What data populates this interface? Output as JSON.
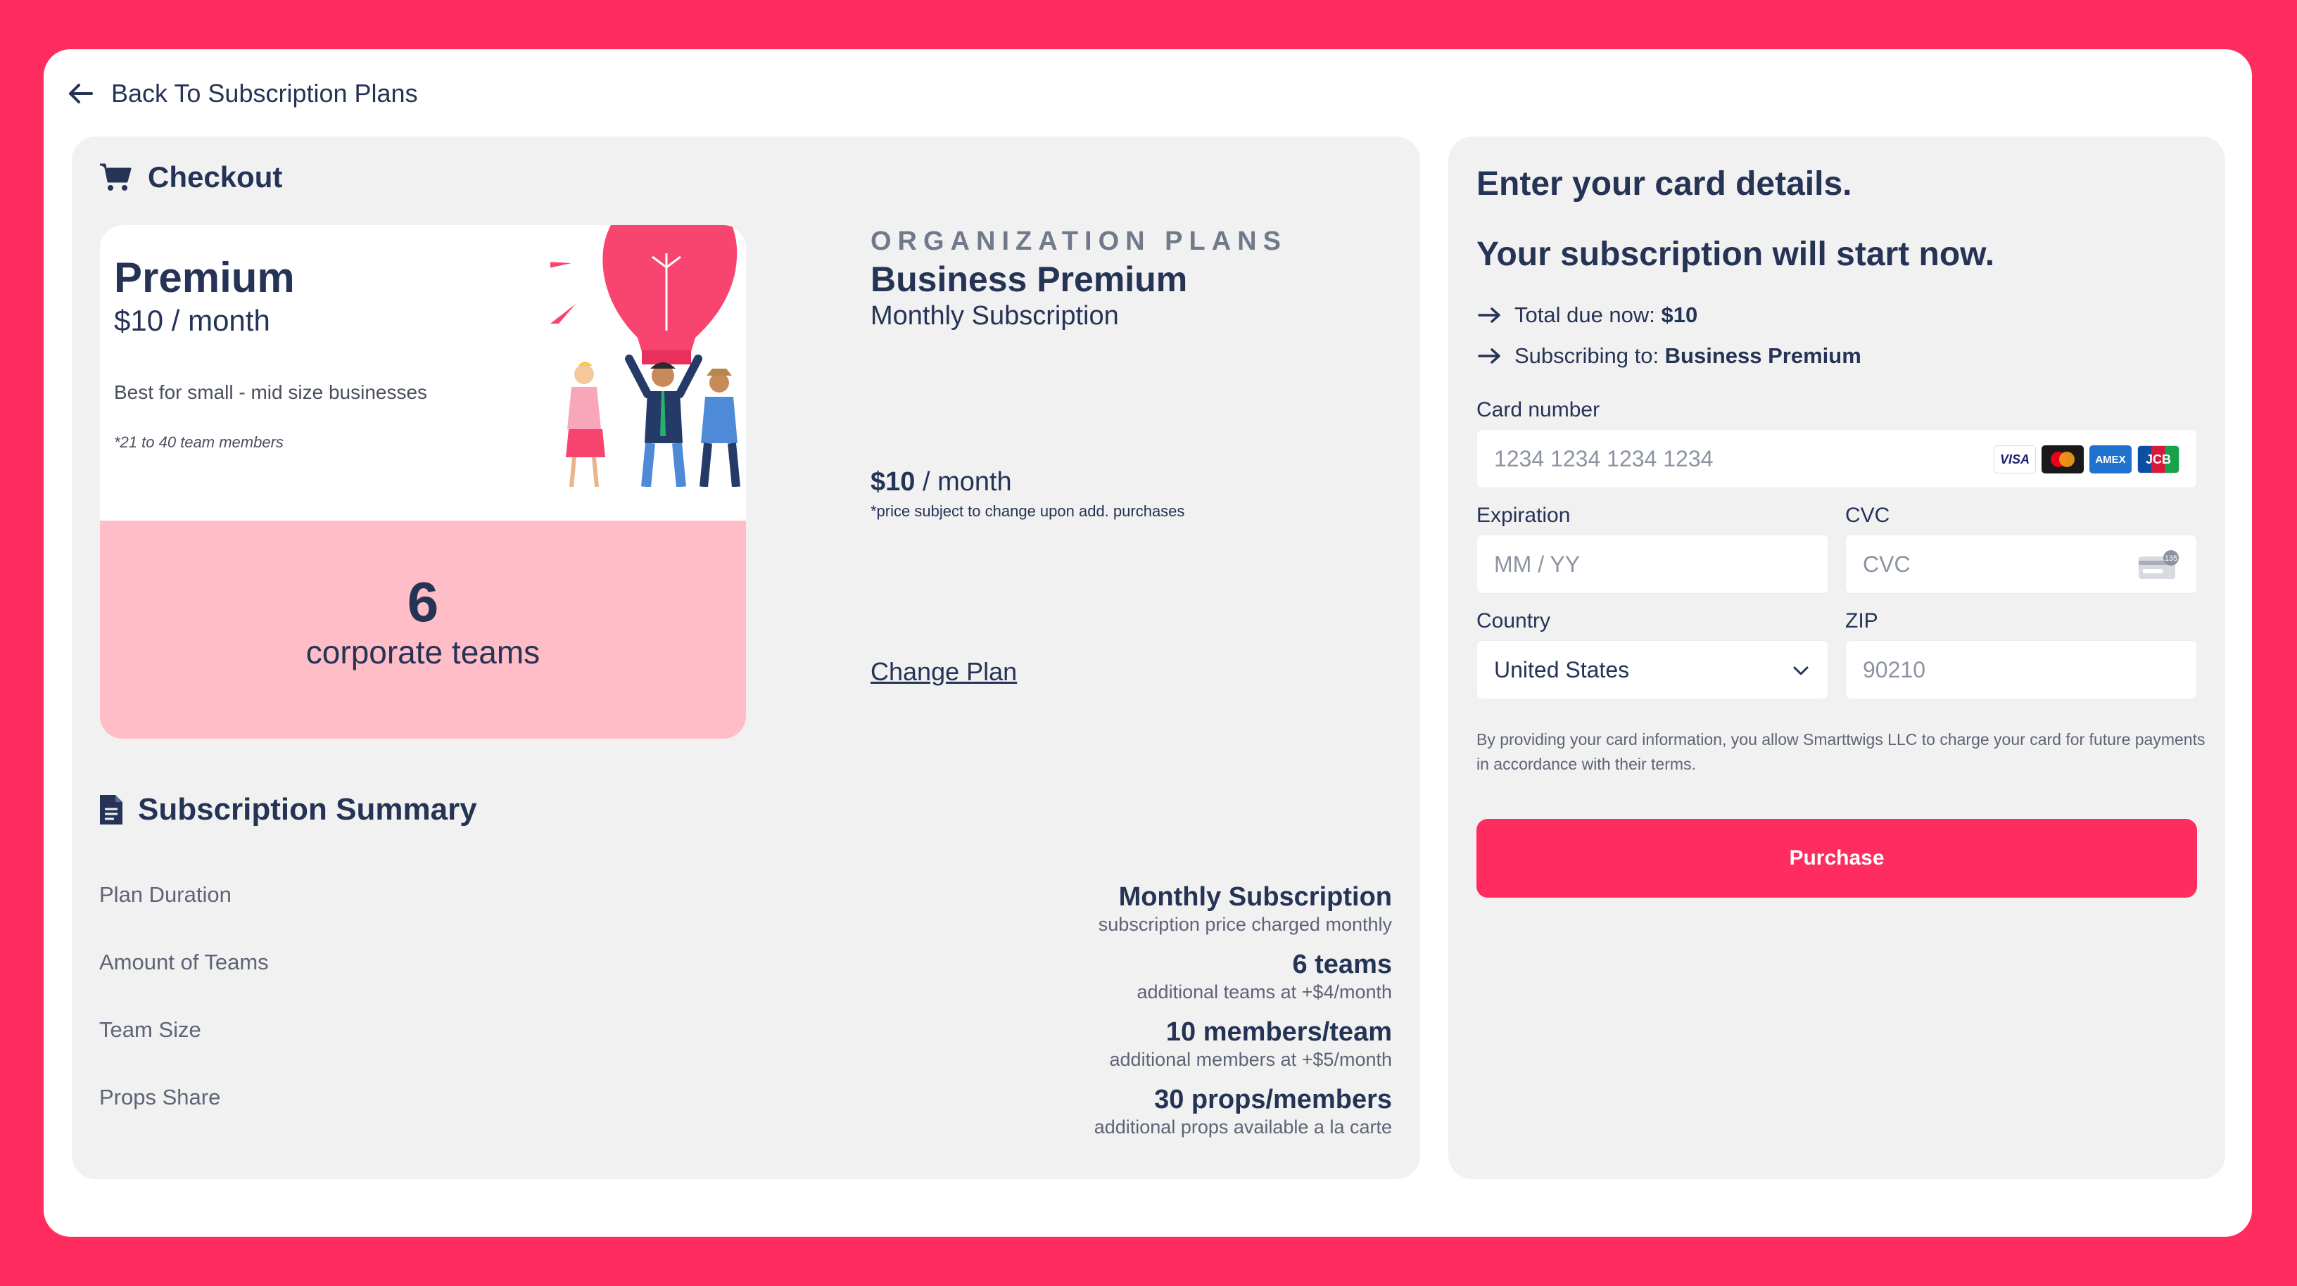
{
  "nav": {
    "back_label": "Back To Subscription Plans"
  },
  "checkout": {
    "title": "Checkout",
    "plan_card": {
      "name": "Premium",
      "price": "$10 / month",
      "description": "Best for small - mid size businesses",
      "note": "*21 to 40 team members",
      "team_count": "6",
      "team_label": "corporate teams"
    },
    "org": {
      "eyebrow": "ORGANIZATION PLANS",
      "name": "Business Premium",
      "subscription": "Monthly Subscription",
      "price_amount": "$10",
      "price_unit": " / month",
      "price_note": "*price subject to change upon add. purchases",
      "change_plan": "Change Plan"
    }
  },
  "summary": {
    "title": "Subscription Summary",
    "rows": [
      {
        "label": "Plan Duration",
        "value": "Monthly Subscription",
        "sub": "subscription price charged monthly"
      },
      {
        "label": "Amount of Teams",
        "value": "6 teams",
        "sub": "additional teams at +$4/month"
      },
      {
        "label": "Team Size",
        "value": "10 members/team",
        "sub": "additional members at +$5/month"
      },
      {
        "label": "Props Share",
        "value": "30 props/members",
        "sub": "additional props available a la carte"
      }
    ]
  },
  "payment": {
    "heading1": "Enter your card details.",
    "heading2": "Your subscription will start now.",
    "total_label": "Total due now: ",
    "total_value": "$10",
    "subscribing_label": "Subscribing to: ",
    "subscribing_value": "Business Premium",
    "card_number": {
      "label": "Card number",
      "placeholder": "1234 1234 1234 1234"
    },
    "card_brands": [
      "VISA",
      "mastercard",
      "AMEX",
      "JCB"
    ],
    "expiration": {
      "label": "Expiration",
      "placeholder": "MM / YY"
    },
    "cvc": {
      "label": "CVC",
      "placeholder": "CVC",
      "icon_text": "135"
    },
    "country": {
      "label": "Country",
      "value": "United States"
    },
    "zip": {
      "label": "ZIP",
      "placeholder": "90210"
    },
    "terms": "By providing your card information, you allow Smarttwigs LLC to charge your card for future payments in accordance with their terms.",
    "purchase_label": "Purchase"
  },
  "colors": {
    "accent": "#ff2d5f",
    "text": "#253355",
    "panel": "#f1f1f2",
    "team_card": "#ffbdc7"
  }
}
